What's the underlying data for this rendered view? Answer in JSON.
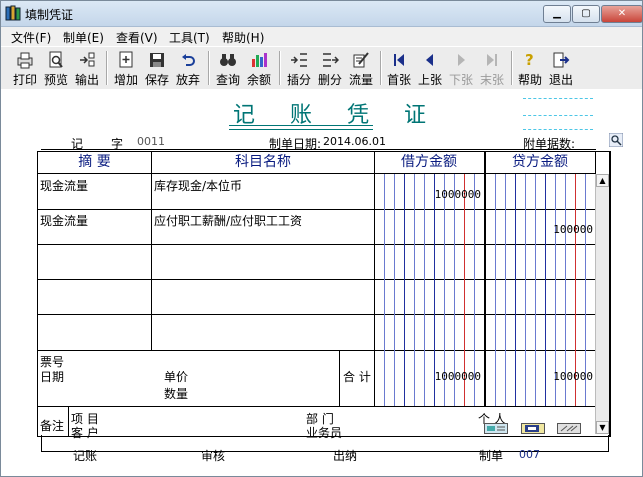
{
  "window": {
    "title": "填制凭证"
  },
  "menu": [
    "文件(F)",
    "制单(E)",
    "查看(V)",
    "工具(T)",
    "帮助(H)"
  ],
  "toolbar": [
    {
      "label": "打印",
      "icon": "printer-icon"
    },
    {
      "label": "预览",
      "icon": "preview-icon"
    },
    {
      "label": "输出",
      "icon": "export-icon"
    },
    {
      "label": "增加",
      "icon": "add-icon"
    },
    {
      "label": "保存",
      "icon": "save-icon"
    },
    {
      "label": "放弃",
      "icon": "undo-icon"
    },
    {
      "label": "查询",
      "icon": "binoculars-icon"
    },
    {
      "label": "余额",
      "icon": "balance-chart-icon"
    },
    {
      "label": "插分",
      "icon": "insert-row-icon"
    },
    {
      "label": "删分",
      "icon": "delete-row-icon"
    },
    {
      "label": "流量",
      "icon": "cashflow-icon"
    },
    {
      "label": "首张",
      "icon": "first-icon"
    },
    {
      "label": "上张",
      "icon": "prev-icon"
    },
    {
      "label": "下张",
      "icon": "next-icon"
    },
    {
      "label": "末张",
      "icon": "last-icon"
    },
    {
      "label": "帮助",
      "icon": "help-icon"
    },
    {
      "label": "退出",
      "icon": "exit-icon"
    }
  ],
  "voucher": {
    "title": "记 账 凭 证",
    "type": "记",
    "no_label": "字",
    "no": "0011",
    "date_label": "制单日期:",
    "date": "2014.06.01",
    "attach_label": "附单据数:",
    "attach_value": "",
    "headers": {
      "summary": "摘 要",
      "account": "科目名称",
      "debit": "借方金额",
      "credit": "贷方金额"
    },
    "rows": [
      {
        "summary": "现金流量",
        "account": "库存现金/本位币",
        "debit": "1000000",
        "credit": ""
      },
      {
        "summary": "现金流量",
        "account": "应付职工薪酬/应付职工工资",
        "debit": "",
        "credit": "100000"
      },
      {
        "summary": "",
        "account": "",
        "debit": "",
        "credit": ""
      },
      {
        "summary": "",
        "account": "",
        "debit": "",
        "credit": ""
      },
      {
        "summary": "",
        "account": "",
        "debit": "",
        "credit": ""
      }
    ],
    "footer_left": {
      "ticket": "票号",
      "date": "日期",
      "price": "单价",
      "qty": "数量"
    },
    "total_label": "合 计",
    "total_debit": "1000000",
    "total_credit": "100000",
    "remarks": {
      "label": "备注",
      "project": "项 目",
      "customer": "客 户",
      "dept": "部 门",
      "salesman": "业务员",
      "person": "个 人"
    },
    "signatures": {
      "book": "记账",
      "audit": "审核",
      "cashier": "出纳",
      "maker": "制单",
      "maker_value": "007"
    }
  }
}
